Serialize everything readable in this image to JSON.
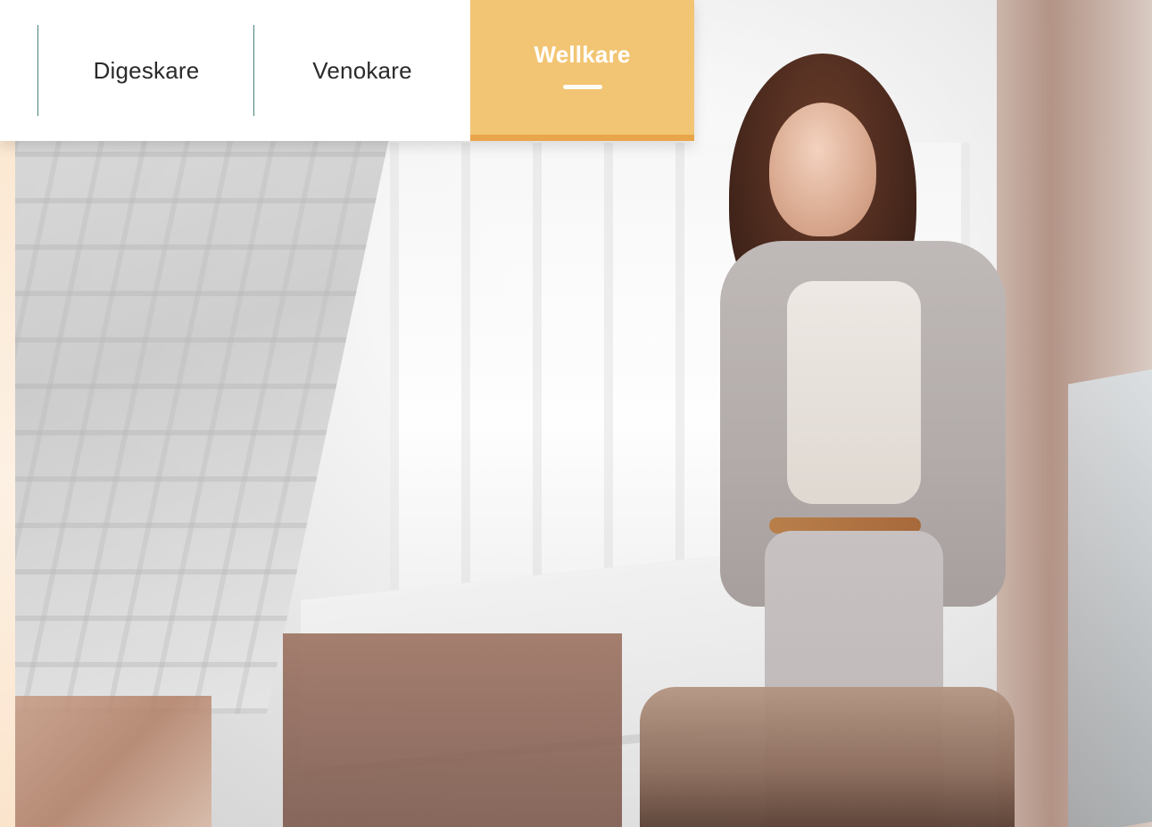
{
  "tabs": {
    "items": [
      {
        "label": "Digeskare"
      },
      {
        "label": "Venokare"
      },
      {
        "label": "Wellkare"
      }
    ],
    "active_index": 2
  },
  "colors": {
    "active_tab_bg": "#f2c574",
    "active_tab_bottom": "#e9a54a",
    "divider": "#3f7b75"
  }
}
